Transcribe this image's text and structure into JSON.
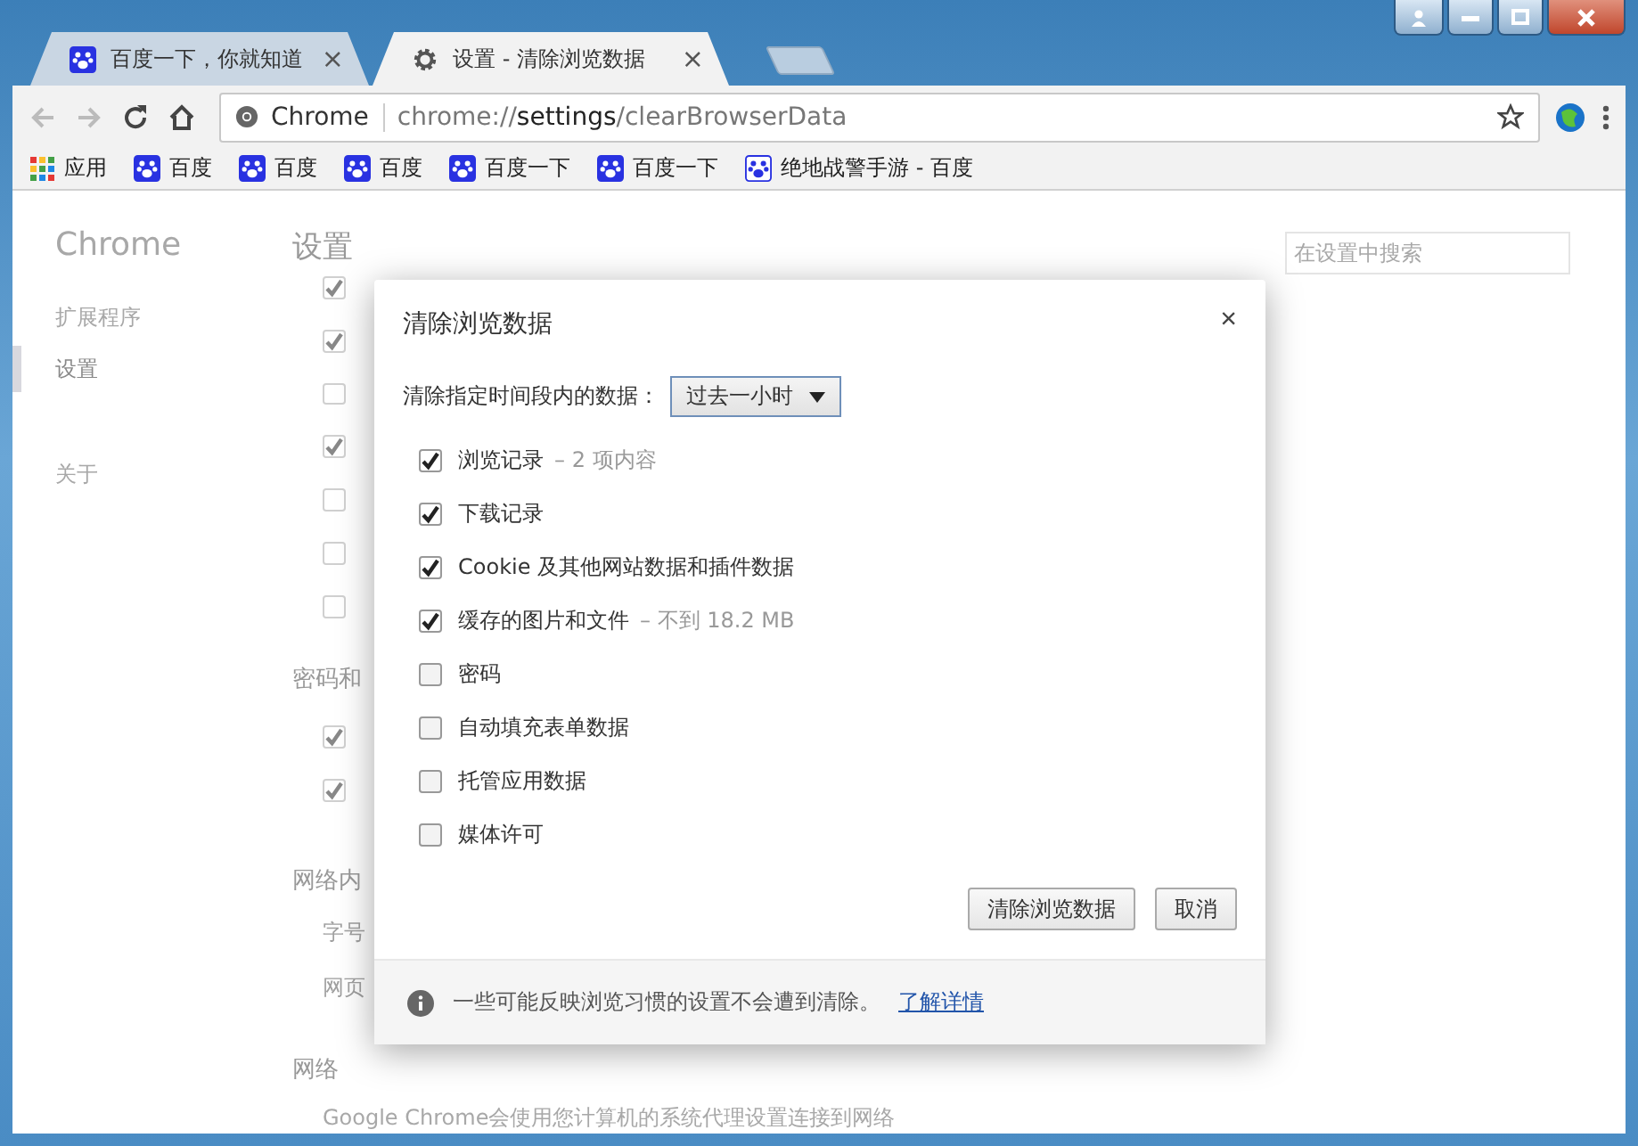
{
  "tabs": [
    {
      "title": "百度一下，你就知道",
      "selected": false,
      "close": "×"
    },
    {
      "title": "设置 - 清除浏览数据",
      "selected": true,
      "close": "×"
    }
  ],
  "omnibox": {
    "site": "Chrome",
    "url_prefix": "chrome://",
    "url_host": "settings",
    "url_path": "/clearBrowserData"
  },
  "bookmarks": [
    {
      "label": "应用"
    },
    {
      "label": "百度"
    },
    {
      "label": "百度"
    },
    {
      "label": "百度"
    },
    {
      "label": "百度一下"
    },
    {
      "label": "百度一下"
    },
    {
      "label": "绝地战警手游 - 百度"
    }
  ],
  "settings_page": {
    "sidebar": {
      "title": "Chrome",
      "items": [
        {
          "label": "扩展程序",
          "selected": false
        },
        {
          "label": "设置",
          "selected": true
        },
        {
          "label": "关于",
          "selected": false
        }
      ]
    },
    "heading": "设置",
    "search": {
      "placeholder": "在设置中搜索"
    },
    "privacy_checks": [
      {
        "checked": true
      },
      {
        "checked": true
      },
      {
        "checked": false
      },
      {
        "checked": true
      },
      {
        "checked": false
      },
      {
        "checked": false
      },
      {
        "checked": false
      }
    ],
    "password_section": {
      "heading": "密码和",
      "checks": [
        {
          "checked": true
        },
        {
          "checked": true
        }
      ]
    },
    "web_content_section": {
      "heading": "网络内",
      "items": [
        "字号",
        "网页"
      ]
    },
    "network_section": {
      "heading": "网络",
      "text": "Google Chrome会使用您计算机的系统代理设置连接到网络"
    }
  },
  "dialog": {
    "title": "清除浏览数据",
    "close": "×",
    "range_label": "清除指定时间段内的数据：",
    "range_value": "过去一小时",
    "options": [
      {
        "label": "浏览记录",
        "detail": "– 2 项内容",
        "checked": true
      },
      {
        "label": "下载记录",
        "checked": true
      },
      {
        "label": "Cookie 及其他网站数据和插件数据",
        "checked": true
      },
      {
        "label": "缓存的图片和文件",
        "detail": "– 不到 18.2 MB",
        "checked": true
      },
      {
        "label": "密码",
        "checked": false
      },
      {
        "label": "自动填充表单数据",
        "checked": false
      },
      {
        "label": "托管应用数据",
        "checked": false
      },
      {
        "label": "媒体许可",
        "checked": false
      }
    ],
    "buttons": [
      {
        "label": "清除浏览数据"
      },
      {
        "label": "取消"
      }
    ],
    "footer": {
      "note": "一些可能反映浏览习惯的设置不会遭到清除。",
      "link": "了解详情"
    }
  }
}
